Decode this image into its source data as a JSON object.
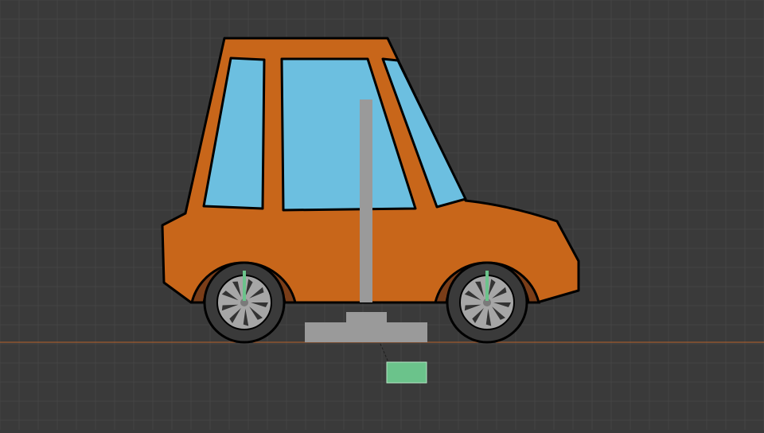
{
  "viewport": {
    "background": "#3a3a3a",
    "grid_minor_color": "#444444",
    "grid_major_color": "#4e4e4e",
    "ground_line_color": "#b8612a"
  },
  "car": {
    "body_color": "#c8661a",
    "outline_color": "#000000",
    "window_color": "#6cbfe0",
    "wheel_arch_color": "#7a3d18",
    "tire_color": "#3a3a3a",
    "rim_color": "#a6a6a6",
    "spoke_color": "#333333",
    "hub_color": "#7a7a7a"
  },
  "rig": {
    "bone_color": "#9a9a9a",
    "wheel_bone_color": "#6bc38b",
    "root_control_color": "#6bc38b"
  },
  "icons": {
    "front_wheel": "wheel-icon",
    "rear_wheel": "wheel-icon"
  }
}
